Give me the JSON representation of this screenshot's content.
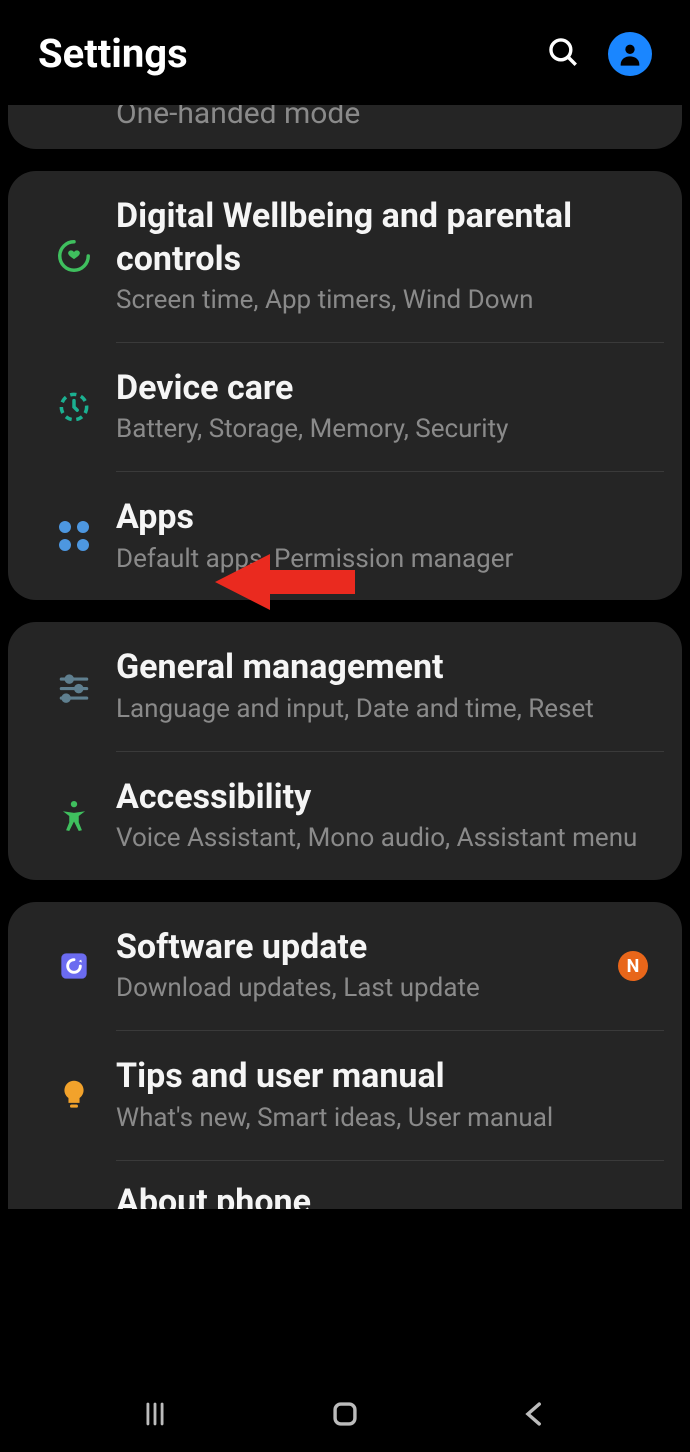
{
  "header": {
    "title": "Settings"
  },
  "partial_top": {
    "subtitle": "One-handed mode"
  },
  "groups": [
    {
      "items": [
        {
          "icon": "wellbeing",
          "title": "Digital Wellbeing and parental controls",
          "subtitle": "Screen time, App timers, Wind Down"
        },
        {
          "icon": "devicecare",
          "title": "Device care",
          "subtitle": "Battery, Storage, Memory, Security"
        },
        {
          "icon": "apps",
          "title": "Apps",
          "subtitle": "Default apps, Permission manager",
          "annotated": true
        }
      ]
    },
    {
      "items": [
        {
          "icon": "general",
          "title": "General management",
          "subtitle": "Language and input, Date and time, Reset"
        },
        {
          "icon": "accessibility",
          "title": "Accessibility",
          "subtitle": "Voice Assistant, Mono audio, Assistant menu"
        }
      ]
    },
    {
      "items": [
        {
          "icon": "software",
          "title": "Software update",
          "subtitle": "Download updates, Last update",
          "badge": "N"
        },
        {
          "icon": "tips",
          "title": "Tips and user manual",
          "subtitle": "What's new, Smart ideas, User manual"
        }
      ],
      "peek": {
        "title": "About phone"
      }
    }
  ],
  "colors": {
    "wellbeing": "#3fbf5e",
    "devicecare": "#1bb191",
    "apps": "#4d97e0",
    "general": "#5f7f8f",
    "accessibility": "#3fbf5e",
    "software": "#6b6bf0",
    "tips": "#f2a22b",
    "badge": "#e8661a",
    "avatar": "#1a86ff",
    "arrow": "#ea2a1f"
  }
}
